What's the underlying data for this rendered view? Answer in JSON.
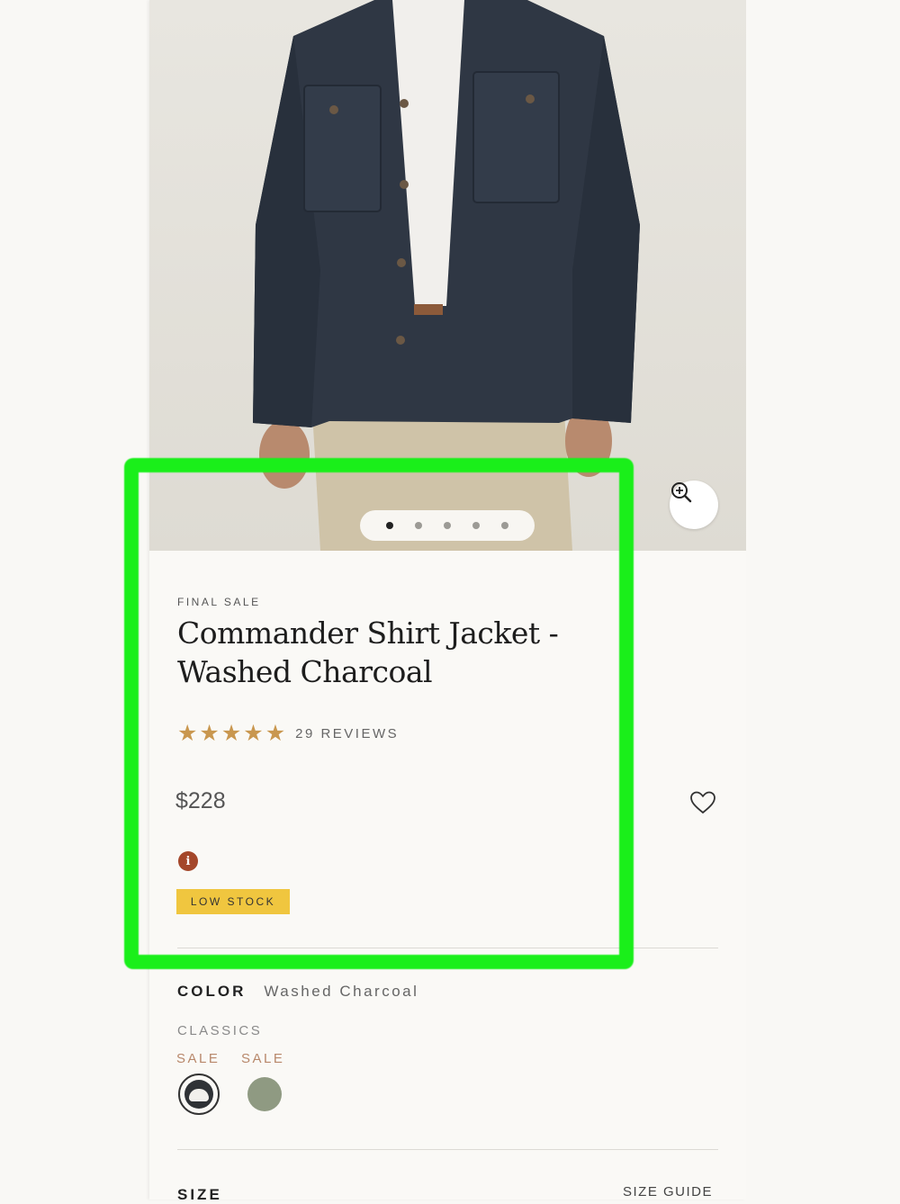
{
  "product": {
    "tag": "FINAL SALE",
    "title": "Commander Shirt Jacket - Washed Charcoal",
    "rating": 5,
    "reviews": "29 REVIEWS",
    "price": "$228",
    "stock_badge": "LOW STOCK"
  },
  "gallery": {
    "image_count": 5,
    "active_index": 0,
    "zoom_icon": "zoom-in-icon"
  },
  "color": {
    "label": "COLOR",
    "selected": "Washed Charcoal",
    "group": "CLASSICS",
    "swatches": [
      {
        "sale_label": "SALE",
        "color": "#2f3236",
        "selected": true
      },
      {
        "sale_label": "SALE",
        "color": "#8f9a82",
        "selected": false
      }
    ]
  },
  "size": {
    "label": "SIZE",
    "guide_link": "SIZE GUIDE"
  },
  "icons": {
    "wishlist": "heart-icon",
    "info": "info-icon",
    "rating": "star-icon"
  },
  "colors": {
    "accent_star": "#c9974f",
    "badge_bg": "#f0c63f",
    "info_bg": "#a4472a",
    "sale_text": "#b8886b",
    "highlight": "#1aef1a"
  }
}
